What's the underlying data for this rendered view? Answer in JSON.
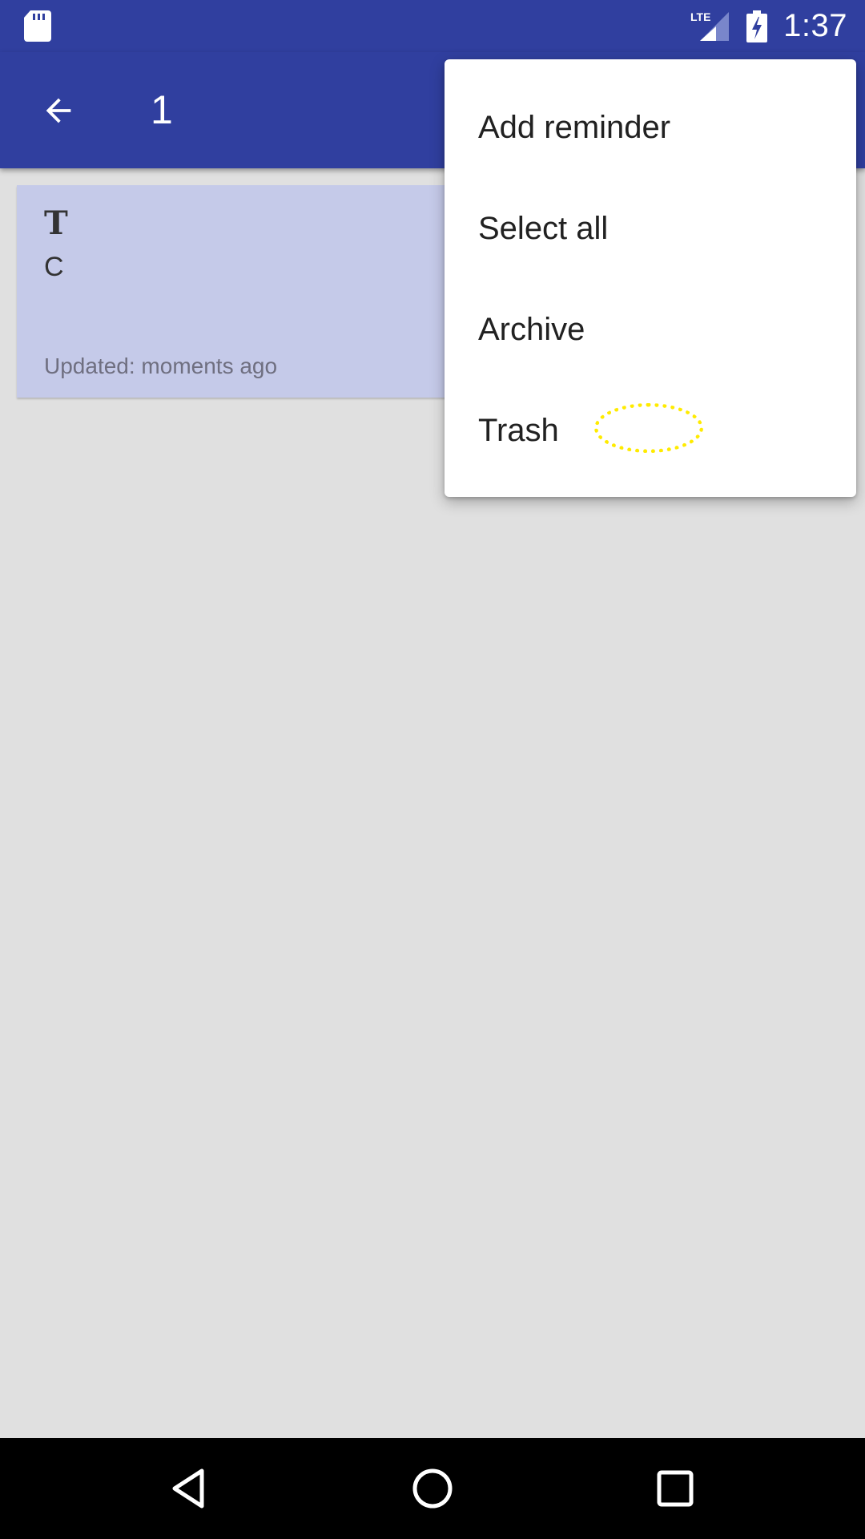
{
  "status_bar": {
    "network_label": "LTE",
    "time": "1:37"
  },
  "app_bar": {
    "selection_count": "1"
  },
  "note": {
    "title": "T",
    "content": "C",
    "updated": "Updated: moments ago",
    "background": "#c5cae9"
  },
  "menu": {
    "items": [
      {
        "label": "Add reminder"
      },
      {
        "label": "Select all"
      },
      {
        "label": "Archive"
      },
      {
        "label": "Trash"
      }
    ]
  },
  "colors": {
    "primary": "#303f9f",
    "primary_dark": "#303f9f",
    "touch_indicator": "#ffeb00",
    "background": "#e0e0e0"
  },
  "icons": {
    "status_left": "sd-card-icon",
    "signal": "lte-signal-icon",
    "battery": "battery-charging-icon",
    "app_bar_nav": "back-arrow-icon",
    "nav": [
      "nav-back-icon",
      "nav-home-icon",
      "nav-recents-icon"
    ]
  }
}
